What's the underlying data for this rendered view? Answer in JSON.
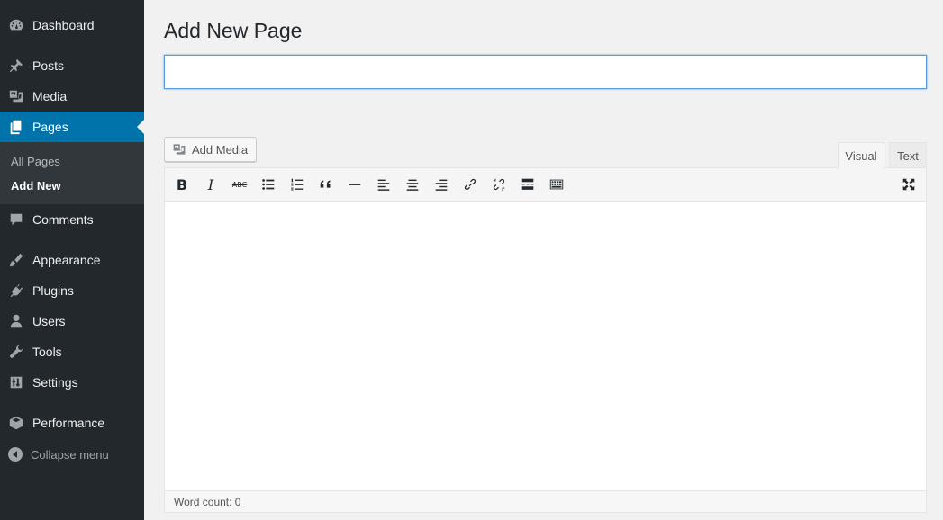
{
  "sidebar": {
    "items": [
      {
        "label": "Dashboard",
        "icon": "dashboard-icon"
      },
      {
        "label": "Posts",
        "icon": "pin-icon"
      },
      {
        "label": "Media",
        "icon": "media-icon"
      },
      {
        "label": "Pages",
        "icon": "pages-icon",
        "active": true
      },
      {
        "label": "Comments",
        "icon": "comment-icon"
      },
      {
        "label": "Appearance",
        "icon": "brush-icon"
      },
      {
        "label": "Plugins",
        "icon": "plug-icon"
      },
      {
        "label": "Users",
        "icon": "user-icon"
      },
      {
        "label": "Tools",
        "icon": "wrench-icon"
      },
      {
        "label": "Settings",
        "icon": "sliders-icon"
      },
      {
        "label": "Performance",
        "icon": "cube-icon"
      }
    ],
    "submenu": [
      {
        "label": "All Pages"
      },
      {
        "label": "Add New",
        "current": true
      }
    ],
    "collapse_label": "Collapse menu"
  },
  "main": {
    "title": "Add New Page",
    "title_input_value": "",
    "add_media_label": "Add Media",
    "tabs": [
      {
        "label": "Visual",
        "active": true
      },
      {
        "label": "Text"
      }
    ],
    "toolbar": {
      "bold": "B",
      "italic": "I",
      "strike": "ABC"
    },
    "word_count": "Word count: 0"
  },
  "colors": {
    "sidebar_bg": "#23282d",
    "active_bg": "#0073aa",
    "page_bg": "#f1f1f1"
  }
}
